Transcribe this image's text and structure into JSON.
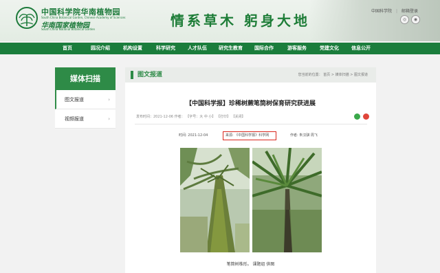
{
  "header": {
    "org_cn": "中国科学院华南植物园",
    "org_en": "South China Botanical Garden, Chinese Academy of Sciences",
    "org_cn2": "华南国家植物园",
    "org_en2": "South China National Botanical Garden",
    "slogan": "情系草木  躬身大地",
    "link_cas": "中国科学院",
    "link_mail": "邮箱登录"
  },
  "nav": [
    "首页",
    "园况介绍",
    "机构设置",
    "科学研究",
    "人才队伍",
    "研究生教育",
    "国际合作",
    "游客服务",
    "党建文化",
    "信息公开"
  ],
  "sidebar": {
    "title": "媒体扫描",
    "items": [
      {
        "label": "图文报道",
        "active": true
      },
      {
        "label": "视频报道",
        "active": false
      }
    ]
  },
  "main": {
    "section": "图文报道",
    "breadcrumb": "您当前的位置： 首页 > 媒体扫描 > 图文报道",
    "article_title": "【中国科学报】珍稀树蕨笔筒树保育研究获进展",
    "meta": "发布时间：2021-12-06  作者： 【字号：大 中 小】  【打印】  【关闭】",
    "time": "时间: 2021-12-04",
    "source": "来源: 《中国科学报》科学网",
    "author": "作者: 朱汉骐 周飞",
    "caption": "笔筒树株形。  课题组 供图"
  },
  "colors": {
    "brand_green": "#1b7d3c",
    "source_highlight": "#d9261c"
  }
}
